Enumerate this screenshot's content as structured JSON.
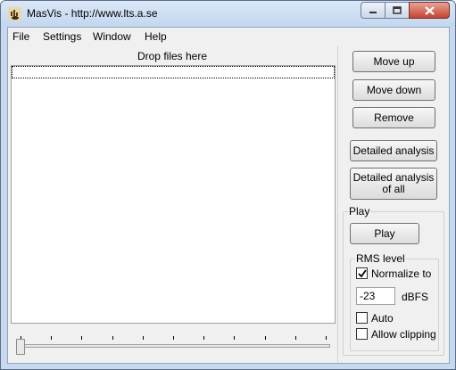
{
  "window": {
    "title": "MasVis - http://www.lts.a.se",
    "icon": "masvis-app-icon"
  },
  "menu": [
    "File",
    "Settings",
    "Window",
    "Help"
  ],
  "file_list": {
    "header": "Drop files here"
  },
  "buttons": {
    "move_up": "Move up",
    "move_down": "Move down",
    "remove": "Remove",
    "detailed_analysis": "Detailed analysis",
    "detailed_analysis_all": "Detailed analysis of all"
  },
  "play_group": {
    "title": "Play",
    "play_button": "Play"
  },
  "rms_group": {
    "title": "RMS level",
    "normalize_label": "Normalize to",
    "normalize_checked": true,
    "level_value": "-23",
    "unit": "dBFS",
    "auto_label": "Auto",
    "auto_checked": false,
    "allow_clipping_label": "Allow clipping",
    "allow_clipping_checked": false
  },
  "position_slider": {
    "value": 0,
    "ticks": 11
  },
  "colors": {
    "titlebar": "#c3d7ef",
    "close_button": "#c7432f",
    "client": "#f0f0f0"
  }
}
